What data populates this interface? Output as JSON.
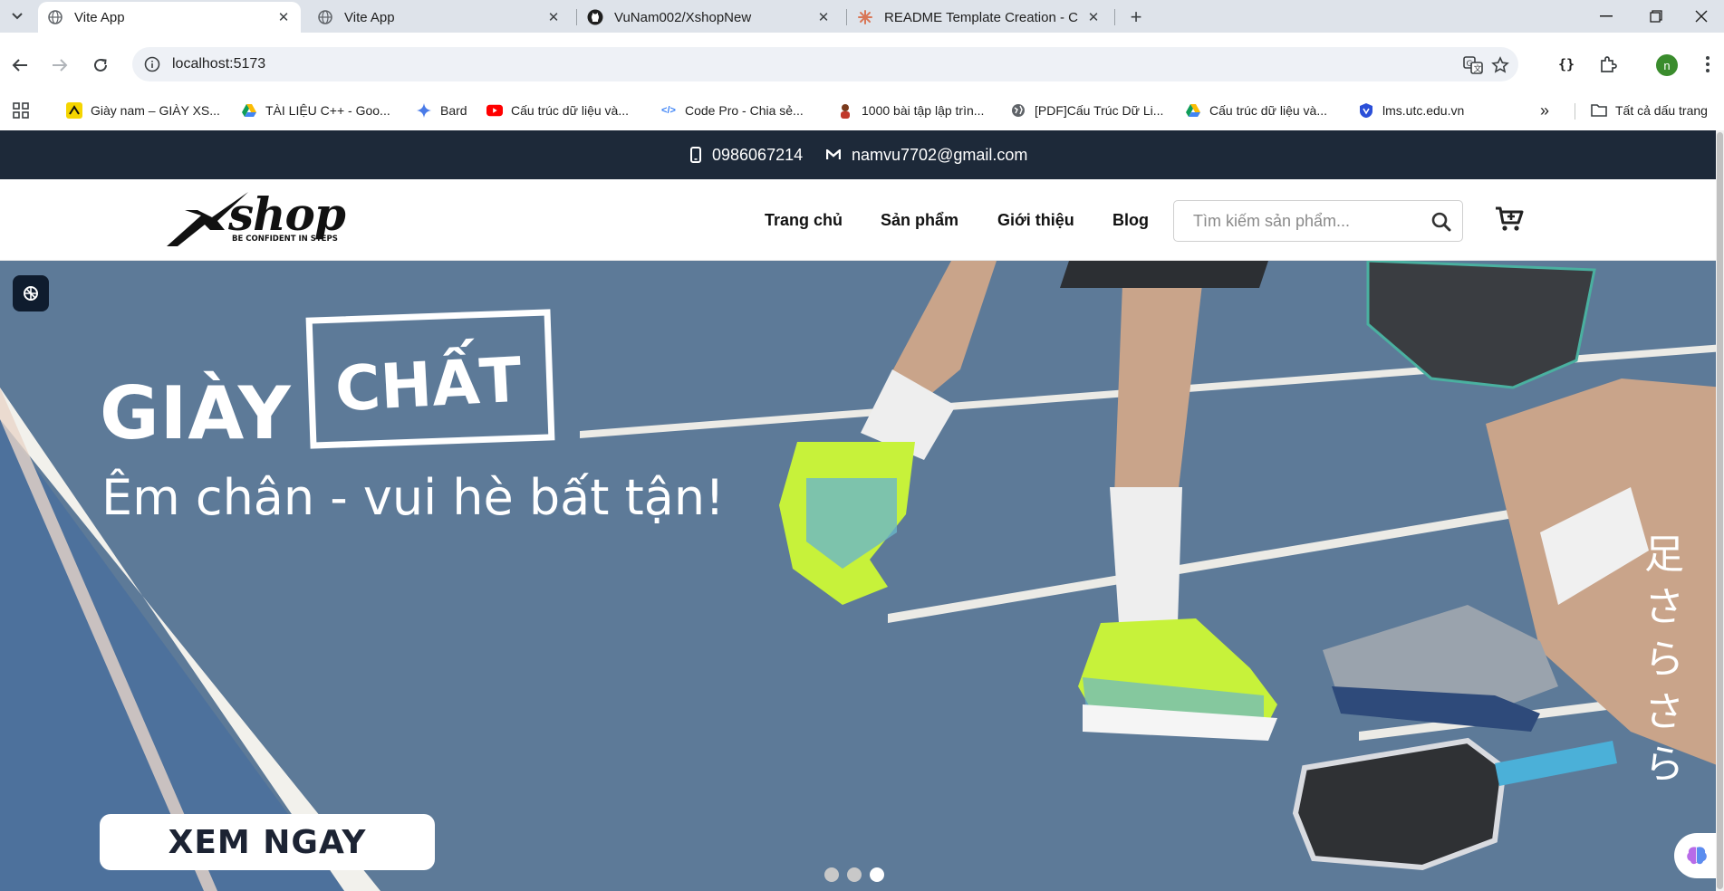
{
  "browser": {
    "tabs": [
      {
        "title": "Vite App",
        "active": true,
        "icon": "globe-icon"
      },
      {
        "title": "Vite App",
        "active": false,
        "icon": "globe-icon"
      },
      {
        "title": "VuNam002/XshopNew",
        "active": false,
        "icon": "github-icon"
      },
      {
        "title": "README Template Creation - C",
        "active": false,
        "icon": "claude-icon"
      }
    ],
    "url": "localhost:5173",
    "profile_initial": "n",
    "bookmarks": [
      {
        "label": "Giày nam – GIÀY XS...",
        "icon": "xshop-favicon"
      },
      {
        "label": "TÀI LIỆU C++ - Goo...",
        "icon": "google-drive-icon"
      },
      {
        "label": "Bard",
        "icon": "bard-icon"
      },
      {
        "label": "Cấu trúc dữ liệu và...",
        "icon": "youtube-icon"
      },
      {
        "label": "Code Pro - Chia sẻ...",
        "icon": "code-icon"
      },
      {
        "label": "1000 bài tập lập trìn...",
        "icon": "avatar-icon"
      },
      {
        "label": "[PDF]Cấu Trúc Dữ Li...",
        "icon": "globe-icon"
      },
      {
        "label": "Cấu trúc dữ liệu và...",
        "icon": "google-drive-icon"
      },
      {
        "label": "lms.utc.edu.vn",
        "icon": "lms-icon"
      }
    ],
    "all_bookmarks": "Tất cả dấu trang"
  },
  "site": {
    "contact": {
      "phone": "0986067214",
      "email": "namvu7702@gmail.com"
    },
    "logo": {
      "wordmark": "shop",
      "tagline": "BE CONFIDENT IN STEPS"
    },
    "nav": [
      "Trang chủ",
      "Sản phẩm",
      "Giới thiệu",
      "Blog"
    ],
    "search_placeholder": "Tìm kiếm sản phẩm...",
    "hero": {
      "title_word": "GIÀY",
      "boxed_word": "CHẤT",
      "subtitle": "Êm chân - vui hè bất tận!",
      "cta": "XEM NGAY",
      "vertical_text": "足さらさら",
      "slide_count": 3,
      "active_slide": 3
    }
  },
  "colors": {
    "topbar": "#1d2939",
    "court": "#5d7a99",
    "accent": "#c7f23a"
  }
}
